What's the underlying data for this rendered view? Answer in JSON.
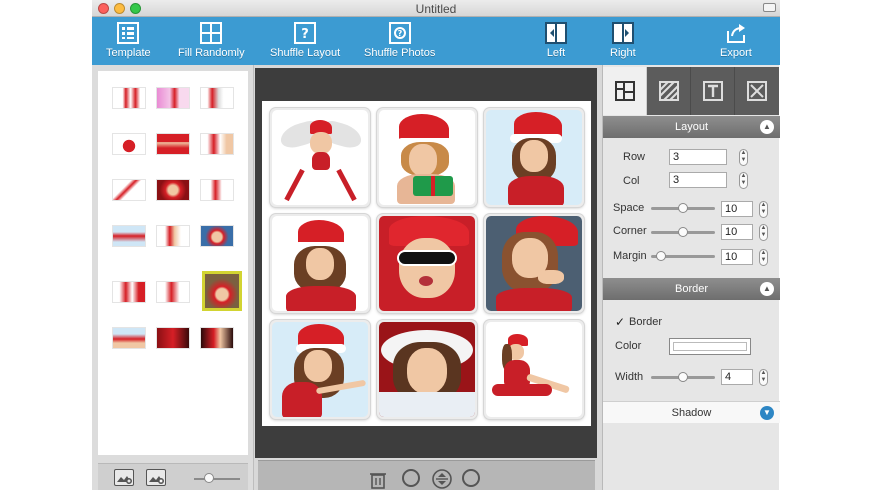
{
  "window": {
    "title": "Untitled"
  },
  "toolbar": {
    "template_label": "Template",
    "fill_randomly_label": "Fill Randomly",
    "shuffle_layout_label": "Shuffle Layout",
    "shuffle_photos_label": "Shuffle Photos",
    "left_label": "Left",
    "right_label": "Right",
    "export_label": "Export"
  },
  "layout": {
    "header": "Layout",
    "row_label": "Row",
    "row_value": "3",
    "col_label": "Col",
    "col_value": "3",
    "space_label": "Space",
    "space_value": "10",
    "space_level": 0.5,
    "corner_label": "Corner",
    "corner_value": "10",
    "corner_level": 0.5,
    "margin_label": "Margin",
    "margin_value": "10",
    "margin_level": 0.15
  },
  "border": {
    "header": "Border",
    "checkbox_label": "Border",
    "checked": "✓",
    "color_label": "Color",
    "color_value": "#ffffff",
    "width_label": "Width",
    "width_value": "4",
    "width_level": 0.5
  },
  "shadow": {
    "header": "Shadow"
  },
  "colors": {
    "toolbar_bg": "#3c9bd2",
    "selected_thumb_border": "#d2d432",
    "santa_red": "#d61f26"
  }
}
